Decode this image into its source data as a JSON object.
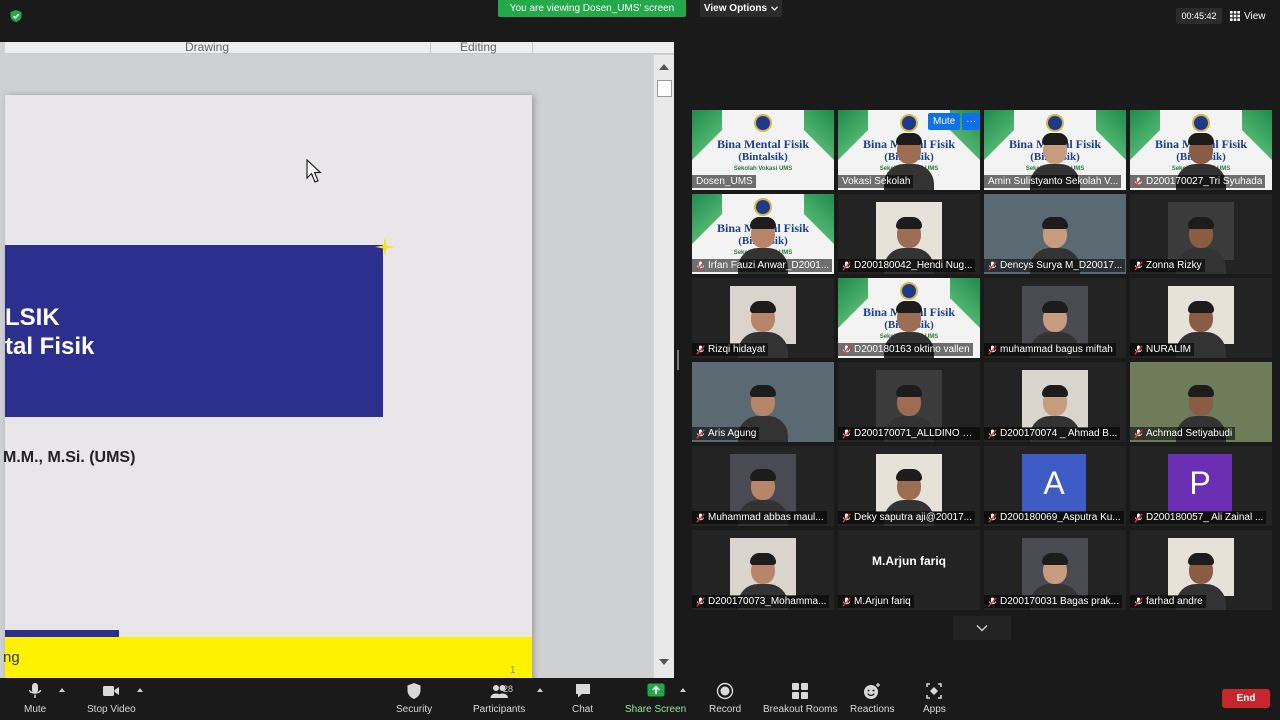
{
  "top_bar": {
    "viewing_banner": "You are viewing Dosen_UMS' screen",
    "view_options": "View Options",
    "timer": "00:45:42",
    "view_label": "View"
  },
  "shared_slide": {
    "ribbon_drawing": "Drawing",
    "ribbon_editing": "Editing",
    "title_line1": "LSIK",
    "title_line2": "tal  Fisik",
    "presenter": "M.M., M.Si. (UMS)",
    "footer_text": "ng",
    "page_number": "1"
  },
  "thumb_slide": {
    "line1": "Bina Mental Fisik",
    "line2": "(Bintalsik)",
    "line3": "Sekolah Vokasi UMS"
  },
  "participants": [
    {
      "name": "Dosen_UMS",
      "muted": false
    },
    {
      "name": "Vokasi Sekolah",
      "muted": false
    },
    {
      "name": "Amin Sulistyanto Sekolah V...",
      "muted": false
    },
    {
      "name": "D200170027_Tri Syuhada",
      "muted": true
    },
    {
      "name": "Irfan Fauzi Anwar_D2001...",
      "muted": true
    },
    {
      "name": "D200180042_Hendi Nug...",
      "muted": true
    },
    {
      "name": "Dencys Surya M_D20017...",
      "muted": true
    },
    {
      "name": "Zonna Rizky",
      "muted": true
    },
    {
      "name": "Rizqi hidayat",
      "muted": true
    },
    {
      "name": "D200180163 oktino vallen",
      "muted": true
    },
    {
      "name": "muhammad bagus miftah",
      "muted": true
    },
    {
      "name": "NURALIM",
      "muted": true
    },
    {
      "name": "Aris Agung",
      "muted": true
    },
    {
      "name": "D200170071_ALLDINO R...",
      "muted": true
    },
    {
      "name": "D200170074 _ Ahmad B...",
      "muted": true
    },
    {
      "name": "Achmad Setiyabudi",
      "muted": true
    },
    {
      "name": "Muhammad abbas maul...",
      "muted": true
    },
    {
      "name": "Deky saputra aji@20017...",
      "muted": true
    },
    {
      "name": "D200180069_Asputra Ku...",
      "muted": true,
      "avatar": "A",
      "avatar_color": "#3f5bc6"
    },
    {
      "name": "D200180057_ Ali Zainal ...",
      "muted": true,
      "avatar": "P",
      "avatar_color": "#6b2fb3"
    },
    {
      "name": "D200170073_Mohamma...",
      "muted": true
    },
    {
      "name": "M.Arjun fariq",
      "muted": true,
      "display_name": "M.Arjun fariq"
    },
    {
      "name": "D200170031 Bagas prak...",
      "muted": true
    },
    {
      "name": "farhad andre",
      "muted": true
    }
  ],
  "hover_popup": {
    "mute": "Mute",
    "more": "···"
  },
  "toolbar": {
    "mute": "Mute",
    "stop_video": "Stop Video",
    "security": "Security",
    "participants": "Participants",
    "participants_count": "28",
    "chat": "Chat",
    "share_screen": "Share Screen",
    "record": "Record",
    "breakout_rooms": "Breakout Rooms",
    "reactions": "Reactions",
    "apps": "Apps",
    "end": "End"
  },
  "colors": {
    "banner_green": "#23a84a",
    "slide_blue": "#2d2f8e",
    "slide_yellow": "#fff200",
    "end_red": "#c8262d",
    "active_speaker": "#e8e36c"
  }
}
